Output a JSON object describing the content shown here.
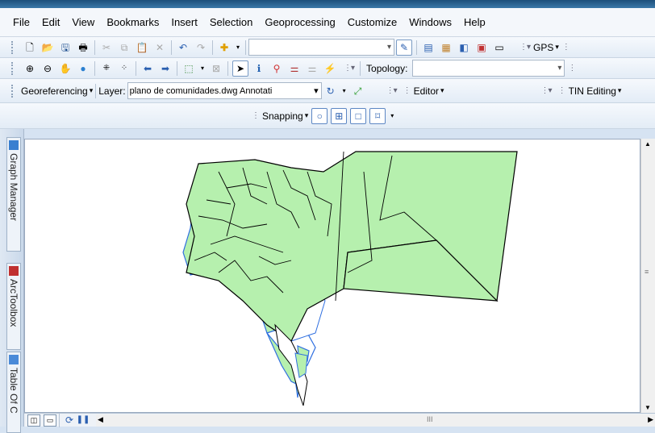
{
  "menu": [
    "File",
    "Edit",
    "View",
    "Bookmarks",
    "Insert",
    "Selection",
    "Geoprocessing",
    "Customize",
    "Windows",
    "Help"
  ],
  "toolbar1": {
    "gps_label": "GPS"
  },
  "toolbar2": {
    "topology_label": "Topology:"
  },
  "toolbar3": {
    "georeferencing_label": "Georeferencing",
    "layer_label": "Layer:",
    "layer_value": "plano de comunidades.dwg Annotati",
    "editor_label": "Editor",
    "tin_label": "TIN Editing"
  },
  "snapping": {
    "label": "Snapping"
  },
  "side_tabs": [
    "Graph Manager",
    "ArcToolbox",
    "Table Of C"
  ],
  "scroll_glyph": "III",
  "colors": {
    "map_fill": "#b6f0ae",
    "map_line_blue": "#2f6fe0",
    "map_line_dark": "#000000",
    "accent": "#3b78a8"
  },
  "icons": [
    "new-document-icon",
    "open-folder-icon",
    "save-icon",
    "print-icon",
    "cut-icon",
    "copy-icon",
    "paste-icon",
    "delete-icon",
    "undo-icon",
    "redo-icon",
    "add-data-icon",
    "editor-toolbar-icon",
    "table-icon",
    "catalog-icon",
    "search-window-icon",
    "python-icon",
    "zoom-in-icon",
    "zoom-out-icon",
    "pan-icon",
    "full-extent-icon",
    "fixed-zoom-in-icon",
    "fixed-zoom-out-icon",
    "back-icon",
    "forward-icon",
    "select-features-icon",
    "clear-selection-icon",
    "select-elements-icon",
    "identify-icon",
    "find-icon",
    "measure-icon",
    "hyperlink-icon"
  ]
}
